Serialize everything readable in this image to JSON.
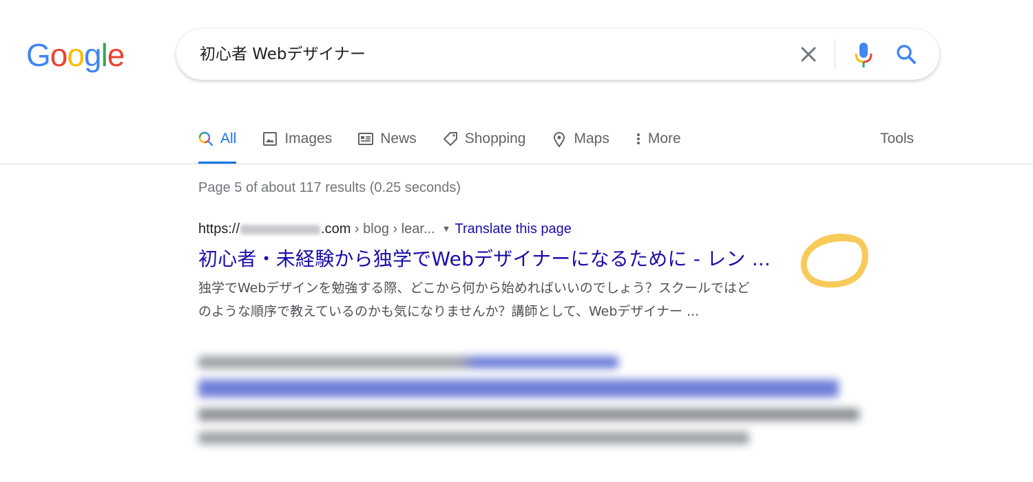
{
  "logo": {
    "letters": [
      "G",
      "o",
      "o",
      "g",
      "l",
      "e"
    ],
    "colors": [
      "#4285f4",
      "#ea4335",
      "#fbbc05",
      "#4285f4",
      "#34a853",
      "#ea4335"
    ]
  },
  "search": {
    "query": "初心者 Webデザイナー"
  },
  "tabs": [
    {
      "label": "All",
      "icon": "search-icon"
    },
    {
      "label": "Images",
      "icon": "image-icon"
    },
    {
      "label": "News",
      "icon": "newspaper-icon"
    },
    {
      "label": "Shopping",
      "icon": "tag-icon"
    },
    {
      "label": "Maps",
      "icon": "map-pin-icon"
    },
    {
      "label": "More",
      "icon": "more-vert-icon"
    }
  ],
  "tools_label": "Tools",
  "result_stats": "Page 5 of about 117 results (0.25 seconds)",
  "results": [
    {
      "cite_prefix": "https://",
      "cite_domain_suffix": ".com",
      "cite_path": " › blog › lear...",
      "translate": "Translate this page",
      "title": "初心者・未経験から独学でWebデザイナーになるために - レン",
      "title_ellipsis": "...",
      "snippet_line1": "独学でWebデザインを勉強する際、どこから何から始めればいいのでしょう？スクールではど",
      "snippet_line2": "のような順序で教えているのかも気になりませんか？講師として、Webデザイナー ..."
    }
  ],
  "colors": {
    "accent": "#1a73e8",
    "link": "#1a0dab",
    "highlight": "#f7c64a"
  }
}
